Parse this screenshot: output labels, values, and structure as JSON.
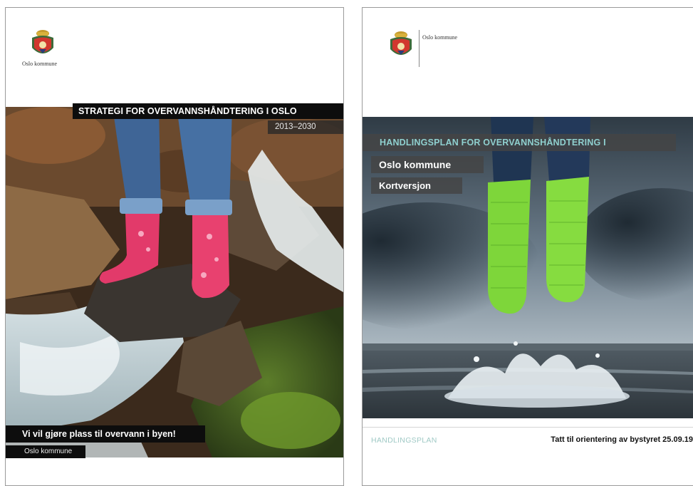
{
  "left_cover": {
    "logo_text": "Oslo kommune",
    "title": "STRATEGI FOR OVERVANNSHÅNDTERING I OSLO",
    "years": "2013–2030",
    "slogan": "Vi vil gjøre plass til overvann i byen!",
    "org": "Oslo kommune"
  },
  "right_cover": {
    "logo_text": "Oslo kommune",
    "title": "HANDLINGSPLAN FOR OVERVANNSHÅNDTERING I",
    "subtitle_1": "Oslo kommune",
    "subtitle_2": "Kortversjon",
    "footer_label": "HANDLINGSPLAN",
    "footer_note": "Tatt til orientering av bystyret 25.09.19"
  },
  "colors": {
    "banner_black": "#0d0d0d",
    "banner_gray": "#444444",
    "title_teal": "#8fd0cf",
    "boots_pink": "#e23a6a",
    "boots_green": "#7ed63a",
    "jeans_blue": "#3f6596"
  },
  "icons": {
    "logo": "oslo-coat-of-arms-icon"
  }
}
